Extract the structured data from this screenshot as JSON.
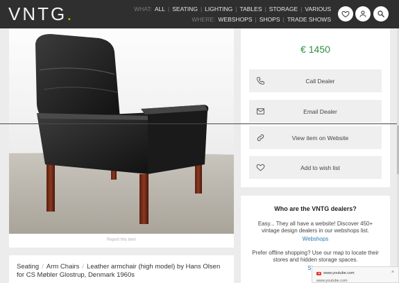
{
  "header": {
    "logo_main": "VNTG",
    "logo_dot": ".",
    "row1": {
      "prefix": "WHAT:",
      "links": [
        "ALL",
        "SEATING",
        "LIGHTING",
        "TABLES",
        "STORAGE",
        "VARIOUS"
      ]
    },
    "row2": {
      "prefix": "WHERE:",
      "links": [
        "WEBSHOPS",
        "SHOPS",
        "TRADE SHOWS"
      ]
    },
    "buttons": [
      "heart-icon",
      "user-icon",
      "search-icon"
    ]
  },
  "image_panel": {
    "report_label": "Report this item"
  },
  "title_card": {
    "breadcrumb": [
      "Seating",
      "Arm Chairs"
    ],
    "separator": "/",
    "title": "Leather armchair (high model) by Hans Olsen for CS Møbler Glostrup, Denmark 1960s"
  },
  "side_panel": {
    "price": "€ 1450",
    "actions": [
      {
        "label": "Call Dealer",
        "icon": "phone-icon"
      },
      {
        "label": "Email Dealer",
        "icon": "envelope-icon"
      },
      {
        "label": "View item on Website",
        "icon": "link-icon"
      },
      {
        "label": "Add to wish list",
        "icon": "heart-icon"
      }
    ]
  },
  "dealers": {
    "heading": "Who are the VNTG dealers?",
    "text1": "Easy... They all have a website! Discover 450+ vintage design dealers in our webshops list.",
    "link1": "Webshops",
    "text2": "Prefer offline shopping? Use our map to locate their stores and hidden storage spaces.",
    "link2": "Shops"
  },
  "popup": {
    "line1": "www.youtube.com",
    "line2": "www.youtube.com",
    "close": "×"
  },
  "colors": {
    "header_bg": "#2f2f2f",
    "logo_dot": "#c8b400",
    "price": "#2f8f3f",
    "link": "#2a7ab0"
  }
}
